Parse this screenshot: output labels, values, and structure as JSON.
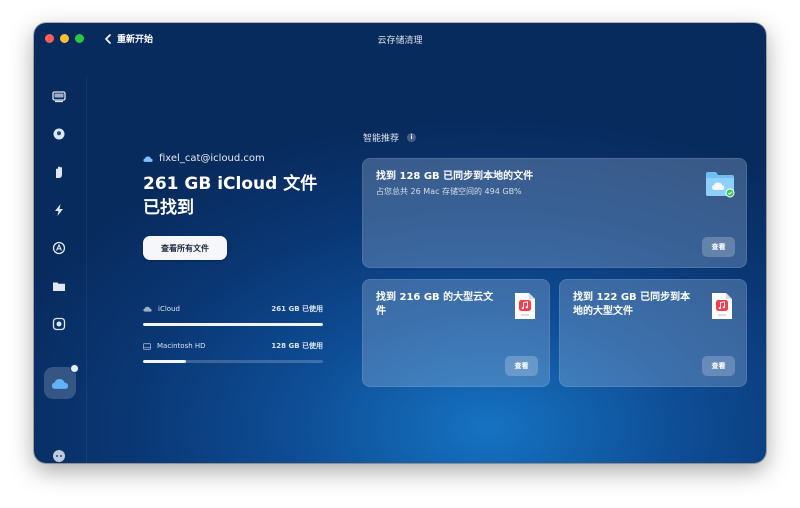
{
  "window": {
    "title": "云存储清理",
    "back_label": "重新开始"
  },
  "sidebar": {
    "items": [
      {
        "icon": "disk-icon"
      },
      {
        "icon": "shield-icon"
      },
      {
        "icon": "hand-icon"
      },
      {
        "icon": "lightning-icon"
      },
      {
        "icon": "apps-icon"
      },
      {
        "icon": "folder-icon"
      },
      {
        "icon": "space-lens-icon"
      },
      {
        "icon": "cloud-icon",
        "active": true
      }
    ],
    "bottom_icon": "assistant-icon"
  },
  "summary": {
    "account": "fixel_cat@icloud.com",
    "headline_line1": "261 GB iCloud 文件",
    "headline_line2": "已找到",
    "view_all_label": "查看所有文件"
  },
  "storage": [
    {
      "name": "iCloud",
      "used": "261 GB 已使用",
      "fill": 1.0
    },
    {
      "name": "Macintosh HD",
      "used": "128 GB 已使用",
      "fill": 0.24
    }
  ],
  "recommendations": {
    "title": "智能推荐",
    "info_label": "i",
    "cards": [
      {
        "title": "找到 128 GB 已同步到本地的文件",
        "subtitle": "占您总共 26 Mac 存储空间的 494 GB%",
        "button": "查看",
        "icon": "icloud-folder-icon"
      },
      {
        "title_line1": "找到 216 GB 的大型云文",
        "title_line2": "件",
        "button": "查看",
        "icon": "music-file-icon"
      },
      {
        "title_line1": "找到 122 GB 已同步到本",
        "title_line2": "地的大型文件",
        "button": "查看",
        "icon": "music-file-icon"
      }
    ]
  },
  "colors": {
    "accent": "#0e4d95",
    "card_bg": "rgba(170,195,230,0.30)",
    "red": "#ff5f57",
    "yellow": "#febc2e",
    "green": "#28c840"
  }
}
